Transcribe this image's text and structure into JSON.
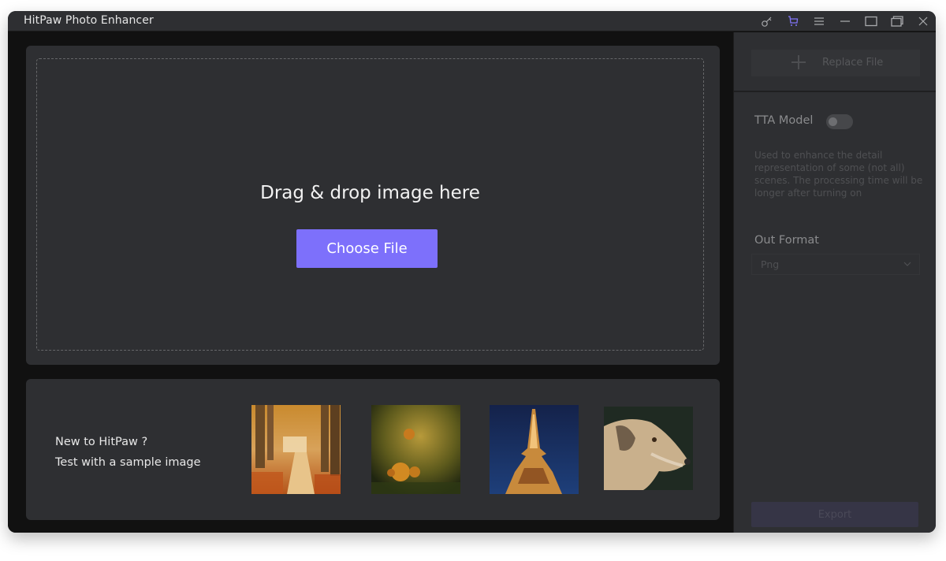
{
  "window": {
    "title": "HitPaw Photo Enhancer",
    "controls": [
      {
        "icon": "key-icon",
        "label": "Register"
      },
      {
        "icon": "cart-icon",
        "label": "Buy"
      },
      {
        "icon": "menu-icon",
        "label": "Menu"
      },
      {
        "icon": "minimize-icon",
        "label": "Minimize"
      },
      {
        "icon": "maximize-icon",
        "label": "Maximize"
      },
      {
        "icon": "restore-icon",
        "label": "Restore"
      },
      {
        "icon": "close-icon",
        "label": "Close"
      }
    ],
    "accent_color": "#7d70fb"
  },
  "dropzone": {
    "prompt": "Drag & drop image here",
    "choose_file_label": "Choose File"
  },
  "samples": {
    "line1": "New to HitPaw ?",
    "line2": "Test with a sample image",
    "images": [
      {
        "name": "autumn-forest-path",
        "alt": "Autumn forest path"
      },
      {
        "name": "pumpkins-in-forest",
        "alt": "Pumpkins in forest"
      },
      {
        "name": "eiffel-tower-night",
        "alt": "Eiffel Tower at night"
      },
      {
        "name": "dog-portrait",
        "alt": "Dog portrait painting"
      }
    ]
  },
  "sidebar": {
    "replace_file_label": "Replace File",
    "tta_model": {
      "label": "TTA Model",
      "enabled": false,
      "description": "Used to enhance the detail representation of some (not all) scenes. The processing time will be longer after turning on"
    },
    "out_format": {
      "label": "Out Format",
      "selected": "Png"
    },
    "export_label": "Export"
  }
}
